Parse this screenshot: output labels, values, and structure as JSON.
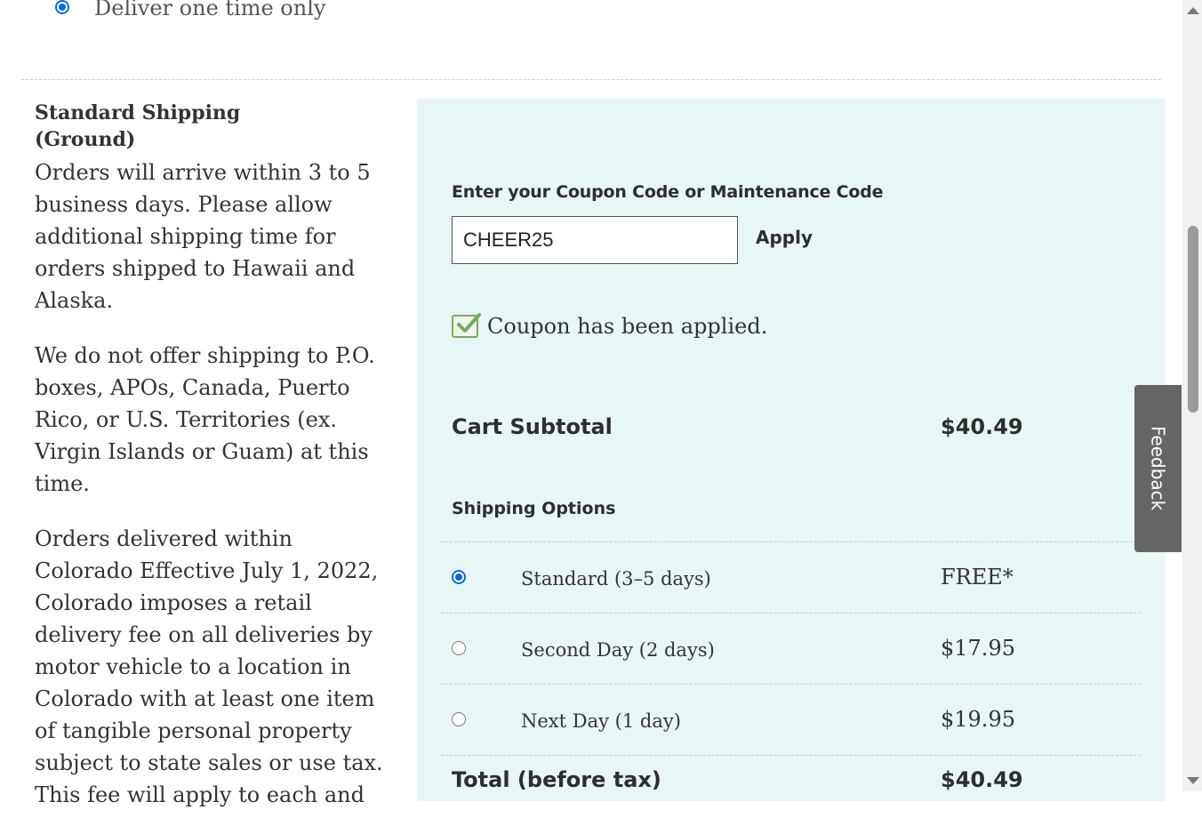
{
  "delivery_frequency": {
    "option_label": "Deliver one time only"
  },
  "shipping_info": {
    "title": "Standard Shipping (Ground)",
    "paragraphs": [
      "Orders will arrive within 3 to 5 business days. Please allow additional shipping time for orders shipped to Hawaii and Alaska.",
      "We do not offer shipping to P.O. boxes, APOs, Canada, Puerto Rico, or U.S. Territories (ex. Virgin Islands or Guam) at this time.",
      "Orders delivered within Colorado Effective July 1, 2022, Colorado imposes a retail delivery fee on all deliveries by motor vehicle to a location in Colorado with at least one item of tangible personal property subject to state sales or use tax. This fee will apply to each and"
    ]
  },
  "coupon": {
    "label": "Enter your Coupon Code or Maintenance Code",
    "value": "CHEER25",
    "apply_label": "Apply",
    "applied_message": "Coupon has been applied."
  },
  "summary": {
    "subtotal_label": "Cart Subtotal",
    "subtotal_value": "$40.49",
    "shipping_options_title": "Shipping Options",
    "options": [
      {
        "label": "Standard (3–5 days)",
        "price": "FREE*",
        "selected": true
      },
      {
        "label": "Second Day (2 days)",
        "price": "$17.95",
        "selected": false
      },
      {
        "label": "Next Day (1 day)",
        "price": "$19.95",
        "selected": false
      }
    ],
    "total_label": "Total (before tax)",
    "total_value": "$40.49"
  },
  "feedback": {
    "label": "Feedback"
  },
  "colors": {
    "panel_bg": "#e8f6f5",
    "radio_accent": "#0a6ad8",
    "check_green": "#7aa863",
    "feedback_bg": "#666666"
  }
}
